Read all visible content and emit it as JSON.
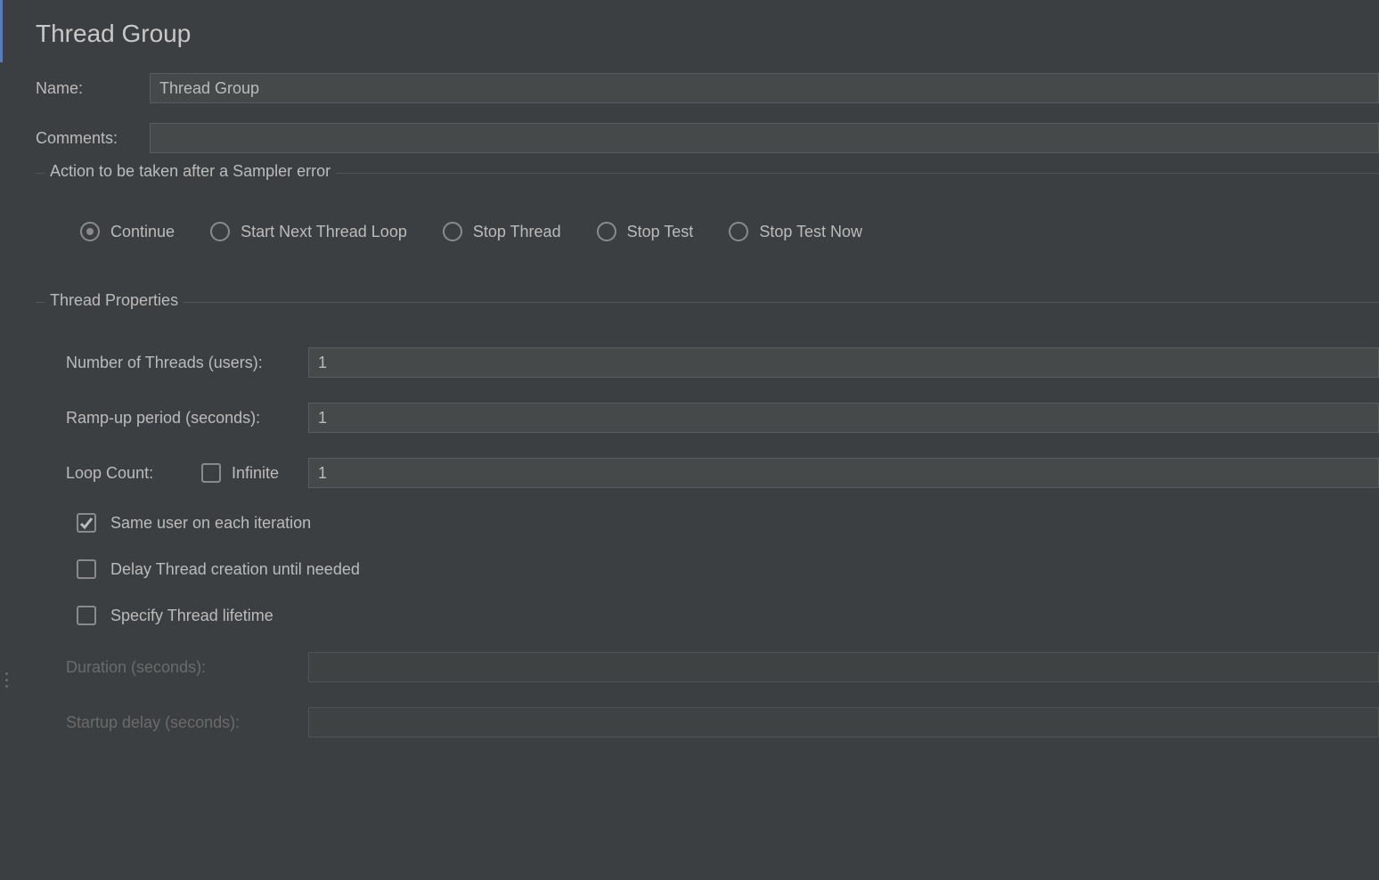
{
  "title": "Thread Group",
  "labels": {
    "name": "Name:",
    "comments": "Comments:"
  },
  "fields": {
    "name": "Thread Group",
    "comments": ""
  },
  "errorAction": {
    "legend": "Action to be taken after a Sampler error",
    "options": {
      "continue": "Continue",
      "startNext": "Start Next Thread Loop",
      "stopThread": "Stop Thread",
      "stopTest": "Stop Test",
      "stopTestNow": "Stop Test Now"
    },
    "selected": "continue"
  },
  "threadProps": {
    "legend": "Thread Properties",
    "labels": {
      "numThreads": "Number of Threads (users):",
      "rampUp": "Ramp-up period (seconds):",
      "loopCount": "Loop Count:",
      "infinite": "Infinite",
      "sameUser": "Same user on each iteration",
      "delayCreation": "Delay Thread creation until needed",
      "specifyLifetime": "Specify Thread lifetime",
      "duration": "Duration (seconds):",
      "startupDelay": "Startup delay (seconds):"
    },
    "values": {
      "numThreads": "1",
      "rampUp": "1",
      "loopCount": "1",
      "duration": "",
      "startupDelay": ""
    },
    "checks": {
      "infinite": false,
      "sameUser": true,
      "delayCreation": false,
      "specifyLifetime": false
    }
  }
}
